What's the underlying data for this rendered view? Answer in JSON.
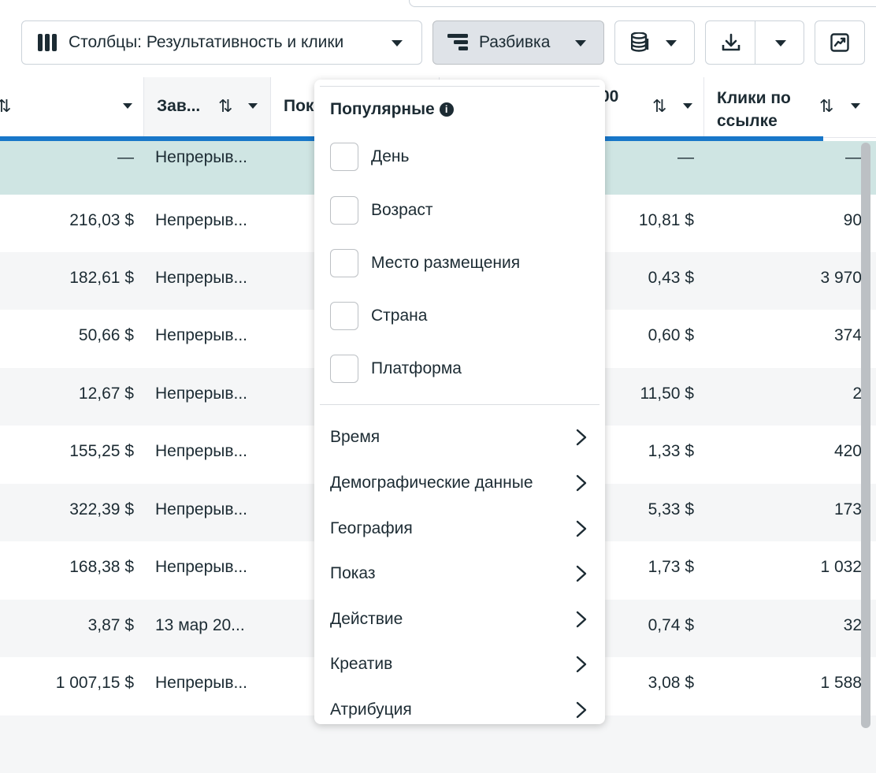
{
  "toolbar": {
    "columns_label": "Столбцы: Результативность и клики",
    "breakdown_label": "Разбивка"
  },
  "table": {
    "headers": [
      {
        "label": ""
      },
      {
        "label": "Зав..."
      },
      {
        "label": "Пок"
      },
      {
        "label": "00"
      },
      {
        "label": "Клики по ссылке"
      }
    ],
    "summary_row": {
      "c1": "—",
      "c2": "Непрерыв...",
      "c4": "—",
      "c5": "—"
    },
    "rows": [
      {
        "c1": "216,03 $",
        "c2": "Непрерыв...",
        "c4": "10,81 $",
        "c5": "90"
      },
      {
        "c1": "182,61 $",
        "c2": "Непрерыв...",
        "c4": "0,43 $",
        "c5": "3 970"
      },
      {
        "c1": "50,66 $",
        "c2": "Непрерыв...",
        "c4": "0,60 $",
        "c5": "374"
      },
      {
        "c1": "12,67 $",
        "c2": "Непрерыв...",
        "c4": "11,50 $",
        "c5": "2"
      },
      {
        "c1": "155,25 $",
        "c2": "Непрерыв...",
        "c4": "1,33 $",
        "c5": "420"
      },
      {
        "c1": "322,39 $",
        "c2": "Непрерыв...",
        "c4": "5,33 $",
        "c5": "173"
      },
      {
        "c1": "168,38 $",
        "c2": "Непрерыв...",
        "c4": "1,73 $",
        "c5": "1 032"
      },
      {
        "c1": "3,87 $",
        "c2": "13 мар 20...",
        "c4": "0,74 $",
        "c5": "32"
      },
      {
        "c1": "1 007,15 $",
        "c2": "Непрерыв...",
        "c4": "3,08 $",
        "c5": "1 588"
      }
    ]
  },
  "dropdown": {
    "popular_title": "Популярные",
    "popular_items": [
      "День",
      "Возраст",
      "Место размещения",
      "Страна",
      "Платформа"
    ],
    "sub_items": [
      "Время",
      "Демографические данные",
      "География",
      "Показ",
      "Действие",
      "Креатив",
      "Атрибуция"
    ]
  }
}
